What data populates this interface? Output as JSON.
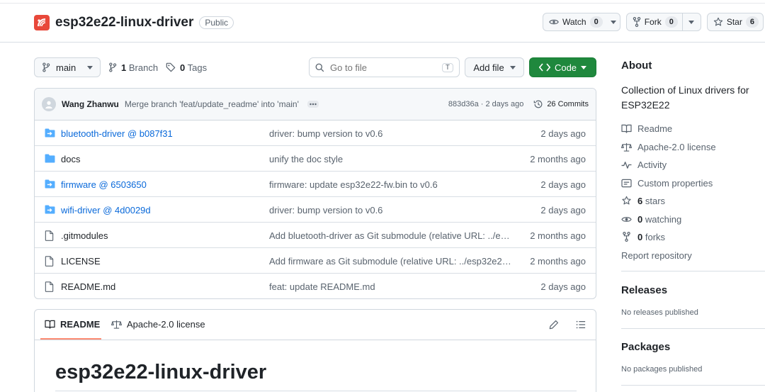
{
  "repo": {
    "name": "esp32e22-linux-driver",
    "visibility": "Public"
  },
  "header_actions": {
    "watch": {
      "label": "Watch",
      "count": "0"
    },
    "fork": {
      "label": "Fork",
      "count": "0"
    },
    "star": {
      "label": "Star",
      "count": "6"
    }
  },
  "toolbar": {
    "branch": "main",
    "branches_count": "1",
    "branches_label": "Branch",
    "tags_count": "0",
    "tags_label": "Tags",
    "go_to_file_placeholder": "Go to file",
    "go_to_file_shortcut": "T",
    "add_file": "Add file",
    "code": "Code"
  },
  "latest_commit": {
    "author": "Wang Zhanwu",
    "message": "Merge branch 'feat/update_readme' into 'main'",
    "meta": "883d36a · 2 days ago",
    "commits_label": "26 Commits"
  },
  "files": [
    {
      "icon": "submodule-folder-icon",
      "name": "bluetooth-driver @ b087f31",
      "link": true,
      "message": "driver: bump version to v0.6",
      "date": "2 days ago"
    },
    {
      "icon": "folder-icon",
      "name": "docs",
      "link": false,
      "message": "unify the doc style",
      "date": "2 months ago"
    },
    {
      "icon": "submodule-folder-icon",
      "name": "firmware @ 6503650",
      "link": true,
      "message": "firmware: update esp32e22-fw.bin to v0.6",
      "date": "2 days ago"
    },
    {
      "icon": "submodule-folder-icon",
      "name": "wifi-driver @ 4d0029d",
      "link": true,
      "message": "driver: bump version to v0.6",
      "date": "2 days ago"
    },
    {
      "icon": "file-icon",
      "name": ".gitmodules",
      "link": false,
      "message": "Add bluetooth-driver as Git submodule (relative URL: ../es…",
      "date": "2 months ago"
    },
    {
      "icon": "file-icon",
      "name": "LICENSE",
      "link": false,
      "message": "Add firmware as Git submodule (relative URL: ../esp32e22…",
      "date": "2 months ago"
    },
    {
      "icon": "file-icon",
      "name": "README.md",
      "link": false,
      "message": "feat: update README.md",
      "date": "2 days ago"
    }
  ],
  "readme": {
    "tab_readme": "README",
    "tab_license": "Apache-2.0 license",
    "title": "esp32e22-linux-driver"
  },
  "about": {
    "heading": "About",
    "description": "Collection of Linux drivers for ESP32E22",
    "readme": "Readme",
    "license": "Apache-2.0 license",
    "activity": "Activity",
    "custom_properties": "Custom properties",
    "stars_count": "6",
    "stars_label": "stars",
    "watching_count": "0",
    "watching_label": "watching",
    "forks_count": "0",
    "forks_label": "forks",
    "report": "Report repository"
  },
  "releases": {
    "heading": "Releases",
    "note": "No releases published"
  },
  "packages": {
    "heading": "Packages",
    "note": "No packages published"
  },
  "colors": {
    "accent_green": "#1f883d",
    "link_blue": "#0969da",
    "folder_blue": "#54aeff",
    "logo_red": "#e8483a"
  }
}
